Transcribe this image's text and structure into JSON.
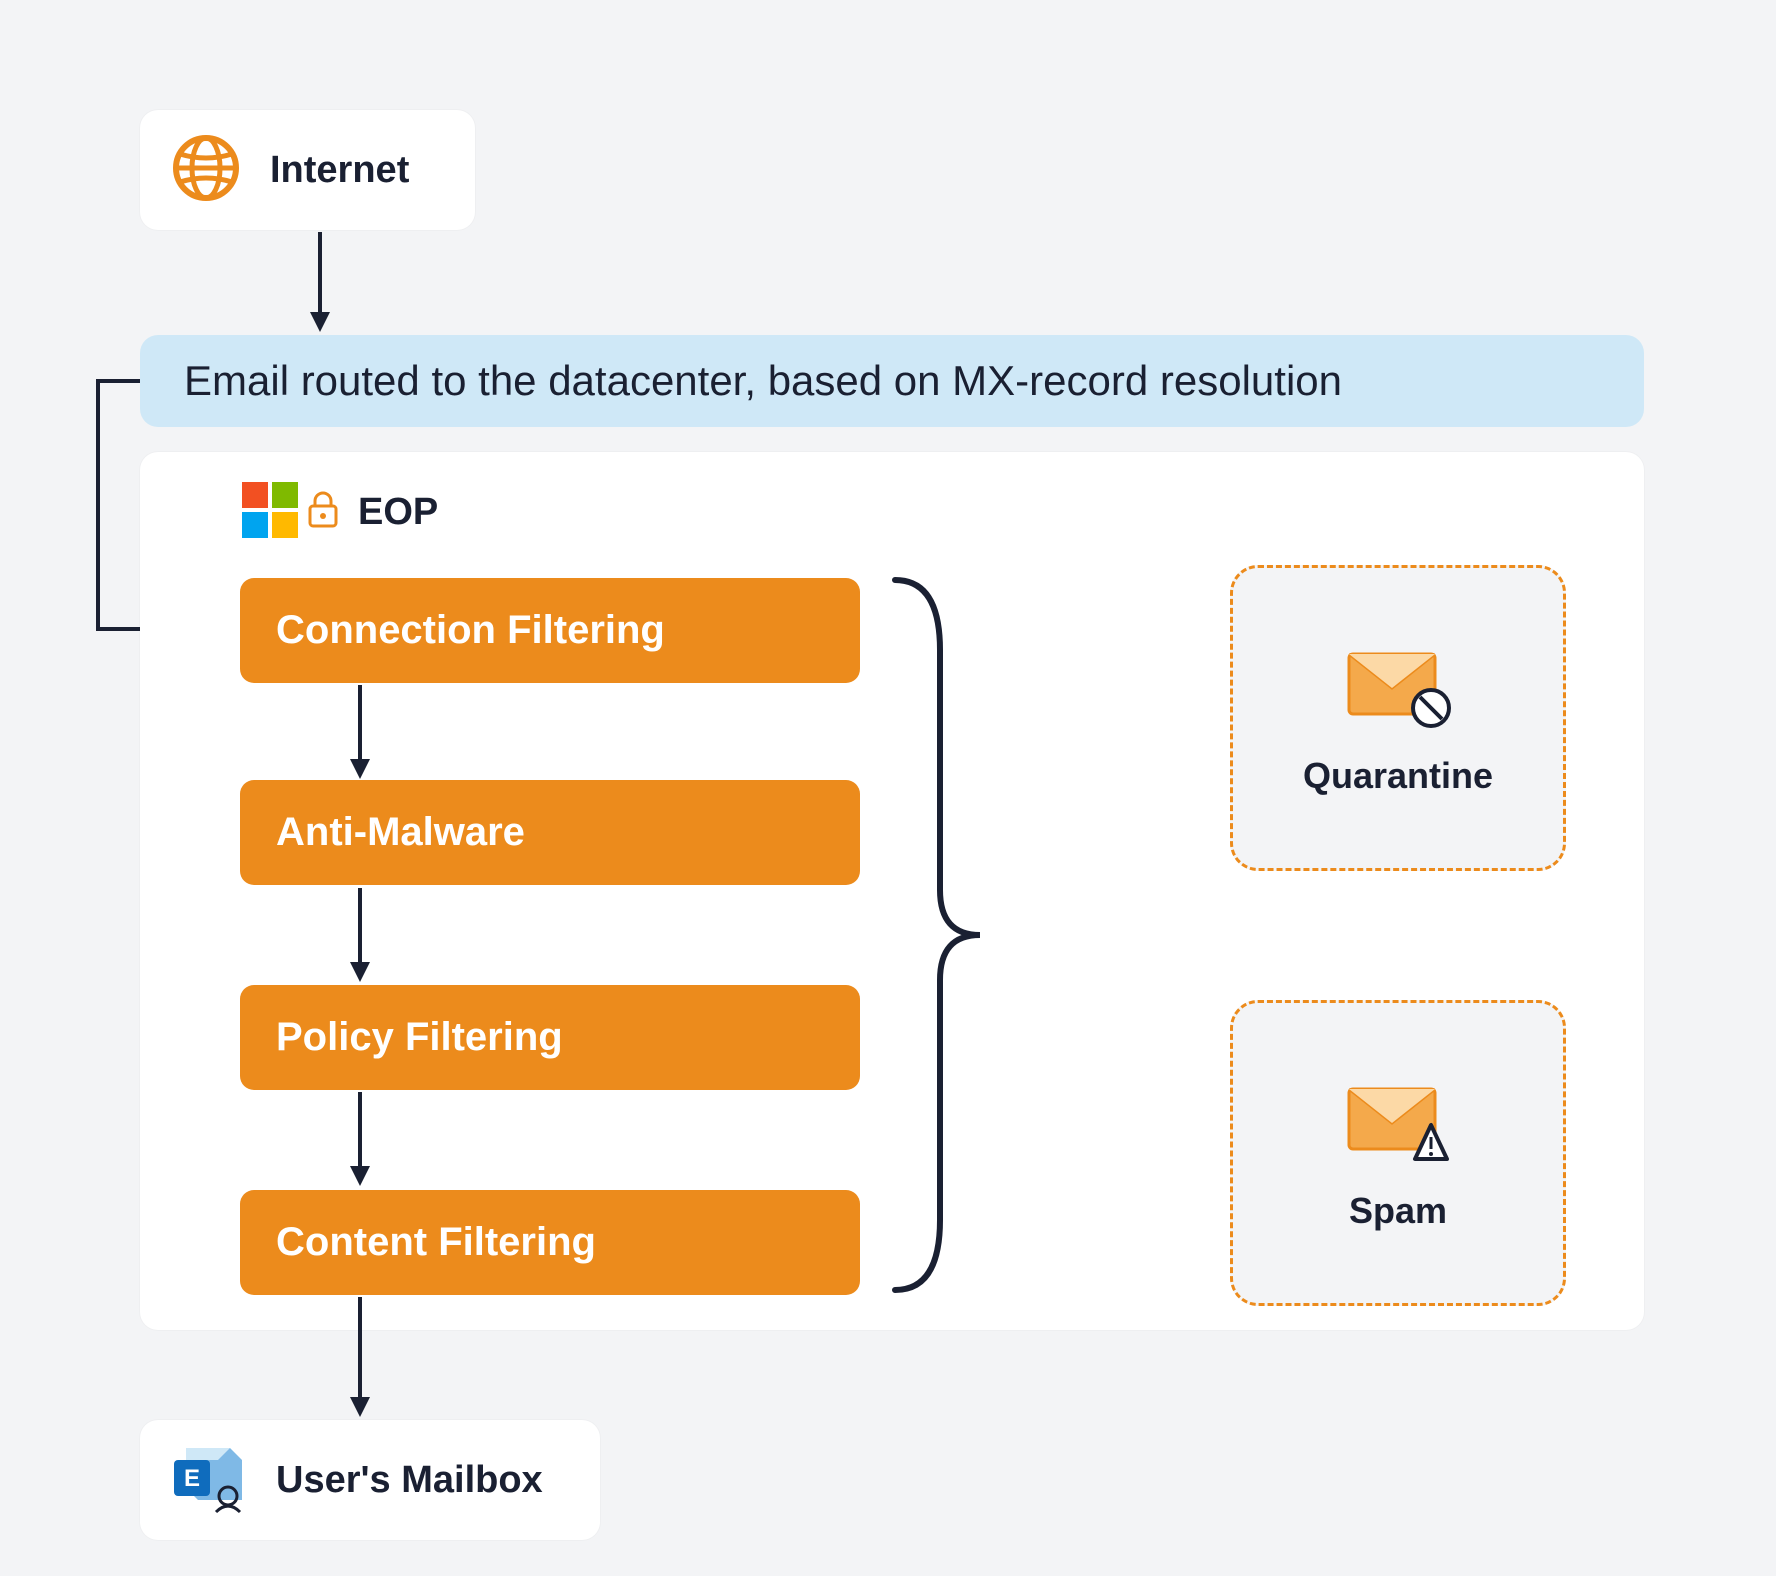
{
  "internet": {
    "label": "Internet"
  },
  "routing_bar": {
    "text": "Email routed to the datacenter, based on MX-record resolution"
  },
  "eop": {
    "label": "EOP",
    "stages": [
      {
        "label": "Connection Filtering"
      },
      {
        "label": "Anti-Malware"
      },
      {
        "label": "Policy Filtering"
      },
      {
        "label": "Content Filtering"
      }
    ]
  },
  "outcomes": {
    "quarantine": {
      "label": "Quarantine"
    },
    "spam": {
      "label": "Spam"
    }
  },
  "mailbox": {
    "label": "User's Mailbox"
  },
  "colors": {
    "accent": "#ec8b1c",
    "blue": "#cfe8f7",
    "ms_red": "#f25022",
    "ms_green": "#7fba00",
    "ms_blue": "#00a4ef",
    "ms_yellow": "#ffb900",
    "exchange": "#0f6cbd"
  }
}
